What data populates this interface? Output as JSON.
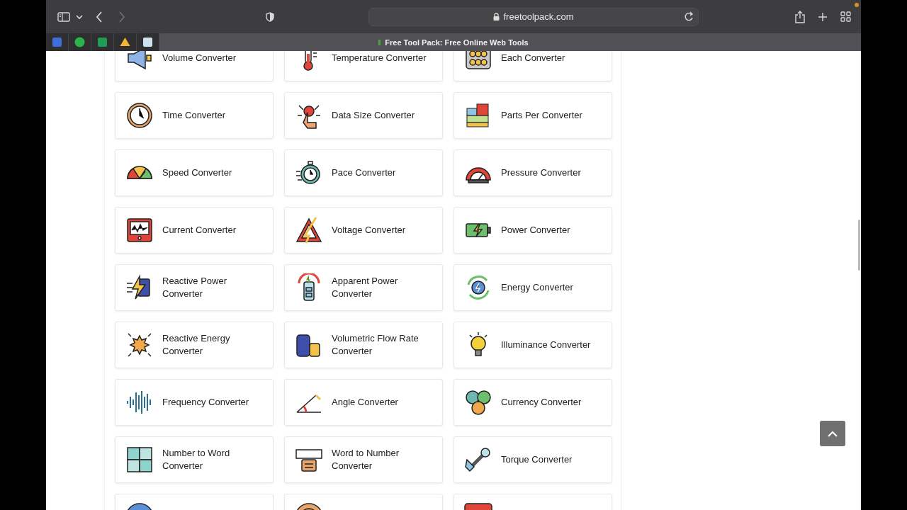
{
  "browser": {
    "url": "freetoolpack.com",
    "tab_title": "Free Tool Pack: Free Online Web Tools",
    "forward_disabled": true
  },
  "tools": [
    {
      "label": "Volume Converter"
    },
    {
      "label": "Temperature Converter"
    },
    {
      "label": "Each Converter"
    },
    {
      "label": "Time Converter"
    },
    {
      "label": "Data Size Converter"
    },
    {
      "label": "Parts Per Converter"
    },
    {
      "label": "Speed Converter"
    },
    {
      "label": "Pace Converter"
    },
    {
      "label": "Pressure Converter"
    },
    {
      "label": "Current Converter"
    },
    {
      "label": "Voltage Converter"
    },
    {
      "label": "Power Converter"
    },
    {
      "label": "Reactive Power Converter"
    },
    {
      "label": "Apparent Power Converter"
    },
    {
      "label": "Energy Converter"
    },
    {
      "label": "Reactive Energy Converter"
    },
    {
      "label": "Volumetric Flow Rate Converter"
    },
    {
      "label": "Illuminance Converter"
    },
    {
      "label": "Frequency Converter"
    },
    {
      "label": "Angle Converter"
    },
    {
      "label": "Currency Converter"
    },
    {
      "label": "Number to Word Converter"
    },
    {
      "label": "Word to Number Converter"
    },
    {
      "label": "Torque Converter"
    }
  ],
  "cut_row": [
    {
      "kind": "card"
    },
    {
      "kind": "card"
    },
    {
      "kind": "card"
    }
  ]
}
